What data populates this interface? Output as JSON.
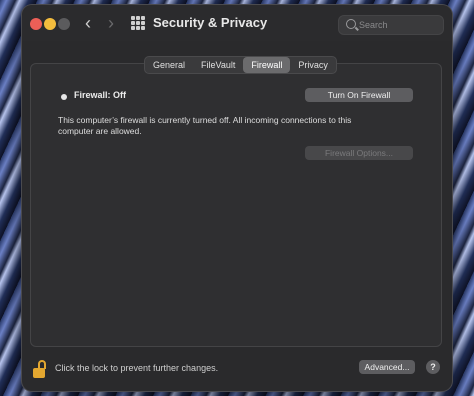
{
  "window": {
    "title": "Security & Privacy"
  },
  "search": {
    "placeholder": "Search"
  },
  "tabs": [
    {
      "label": "General"
    },
    {
      "label": "FileVault"
    },
    {
      "label": "Firewall",
      "active": true
    },
    {
      "label": "Privacy"
    }
  ],
  "firewall": {
    "status": "Firewall: Off",
    "turn_on_label": "Turn On Firewall",
    "description": "This computer’s firewall is currently turned off. All incoming connections to this computer are allowed.",
    "options_label": "Firewall Options..."
  },
  "footer": {
    "lock_text": "Click the lock to prevent further changes.",
    "advanced_label": "Advanced...",
    "help_label": "?"
  },
  "icons": {
    "close": "close-icon",
    "minimize": "minimize-icon",
    "zoom": "zoom-icon",
    "back": "chevron-left-icon",
    "forward": "chevron-right-icon",
    "grid": "grid-icon",
    "search": "search-icon",
    "lock": "lock-icon"
  },
  "colors": {
    "close": "#ec5f57",
    "minimize": "#f4bd3d",
    "lock": "#e3a730"
  }
}
